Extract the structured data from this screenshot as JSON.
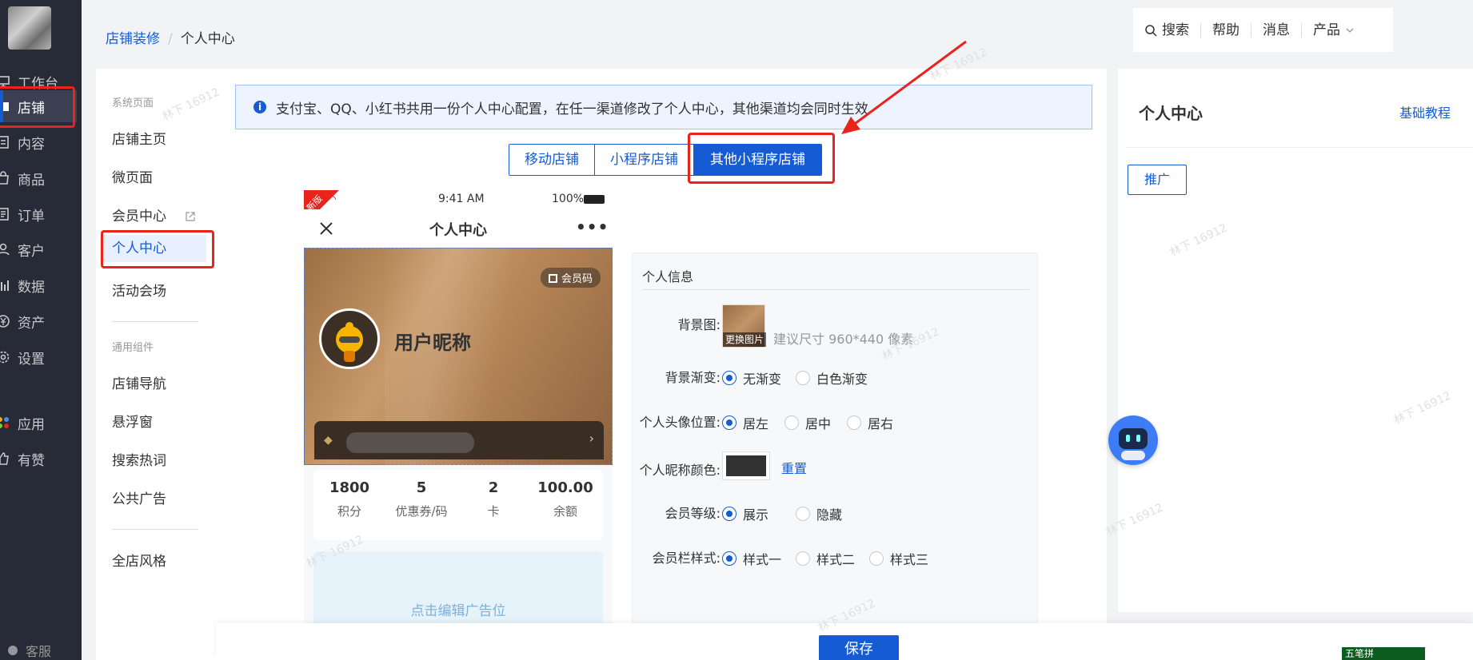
{
  "sidebar": {
    "items": [
      {
        "label": "工作台",
        "icon": "desktop-icon"
      },
      {
        "label": "店铺",
        "icon": "store-icon"
      },
      {
        "label": "内容",
        "icon": "content-icon"
      },
      {
        "label": "商品",
        "icon": "bag-icon"
      },
      {
        "label": "订单",
        "icon": "order-icon"
      },
      {
        "label": "客户",
        "icon": "user-icon"
      },
      {
        "label": "数据",
        "icon": "chart-icon"
      },
      {
        "label": "资产",
        "icon": "yen-icon"
      },
      {
        "label": "设置",
        "icon": "gear-icon"
      },
      {
        "label": "应用",
        "icon": "apps-icon"
      },
      {
        "label": "有赞",
        "icon": "thumb-icon"
      }
    ],
    "active_index": 1,
    "service_label": "客服"
  },
  "breadcrumb": {
    "parent": "店铺装修",
    "current": "个人中心"
  },
  "toptools": {
    "search": "搜索",
    "help": "帮助",
    "messages": "消息",
    "product": "产品"
  },
  "subnav": {
    "group1": "系统页面",
    "items1": [
      "店铺主页",
      "微页面",
      "会员中心",
      "个人中心",
      "活动会场"
    ],
    "group2": "通用组件",
    "items2": [
      "店铺导航",
      "悬浮窗",
      "搜索热词",
      "公共广告"
    ],
    "items3": [
      "全店风格"
    ],
    "active": "个人中心"
  },
  "notice": {
    "text": "支付宝、QQ、小红书共用一份个人中心配置，在任一渠道修改了个人中心，其他渠道均会同时生效"
  },
  "tabs": [
    "移动店铺",
    "小程序店铺",
    "其他小程序店铺"
  ],
  "active_tab_index": 2,
  "phone": {
    "ribbon": "新版",
    "time": "9:41 AM",
    "battery": "100%",
    "title": "个人中心",
    "member_code": "会员码",
    "nickname": "用户昵称",
    "stats": [
      {
        "value": "1800",
        "label": "积分"
      },
      {
        "value": "5",
        "label": "优惠券/码"
      },
      {
        "value": "2",
        "label": "卡"
      },
      {
        "value": "100.00",
        "label": "余额"
      }
    ],
    "ad_text": "点击编辑广告位"
  },
  "panel": {
    "title": "个人信息",
    "bg_label": "背景图:",
    "bg_change": "更换图片",
    "bg_hint": "建议尺寸 960*440 像素",
    "gradient_label": "背景渐变:",
    "gradient_options": [
      "无渐变",
      "白色渐变"
    ],
    "avatar_pos_label": "个人头像位置:",
    "avatar_pos_options": [
      "居左",
      "居中",
      "居右"
    ],
    "nick_color_label": "个人昵称颜色:",
    "nick_color_value": "#323233",
    "reset": "重置",
    "level_label": "会员等级:",
    "level_options": [
      "展示",
      "隐藏"
    ],
    "bar_style_label": "会员栏样式:",
    "bar_style_options": [
      "样式一",
      "样式二",
      "样式三"
    ]
  },
  "right": {
    "title": "个人中心",
    "tutorial": "基础教程",
    "promote": "推广"
  },
  "footer": {
    "save": "保存"
  },
  "ime": "五笔拼",
  "watermark": "林下 16912",
  "colors": {
    "primary": "#155bd4",
    "sidebar": "#272a37",
    "highlight": "#e8241b"
  }
}
